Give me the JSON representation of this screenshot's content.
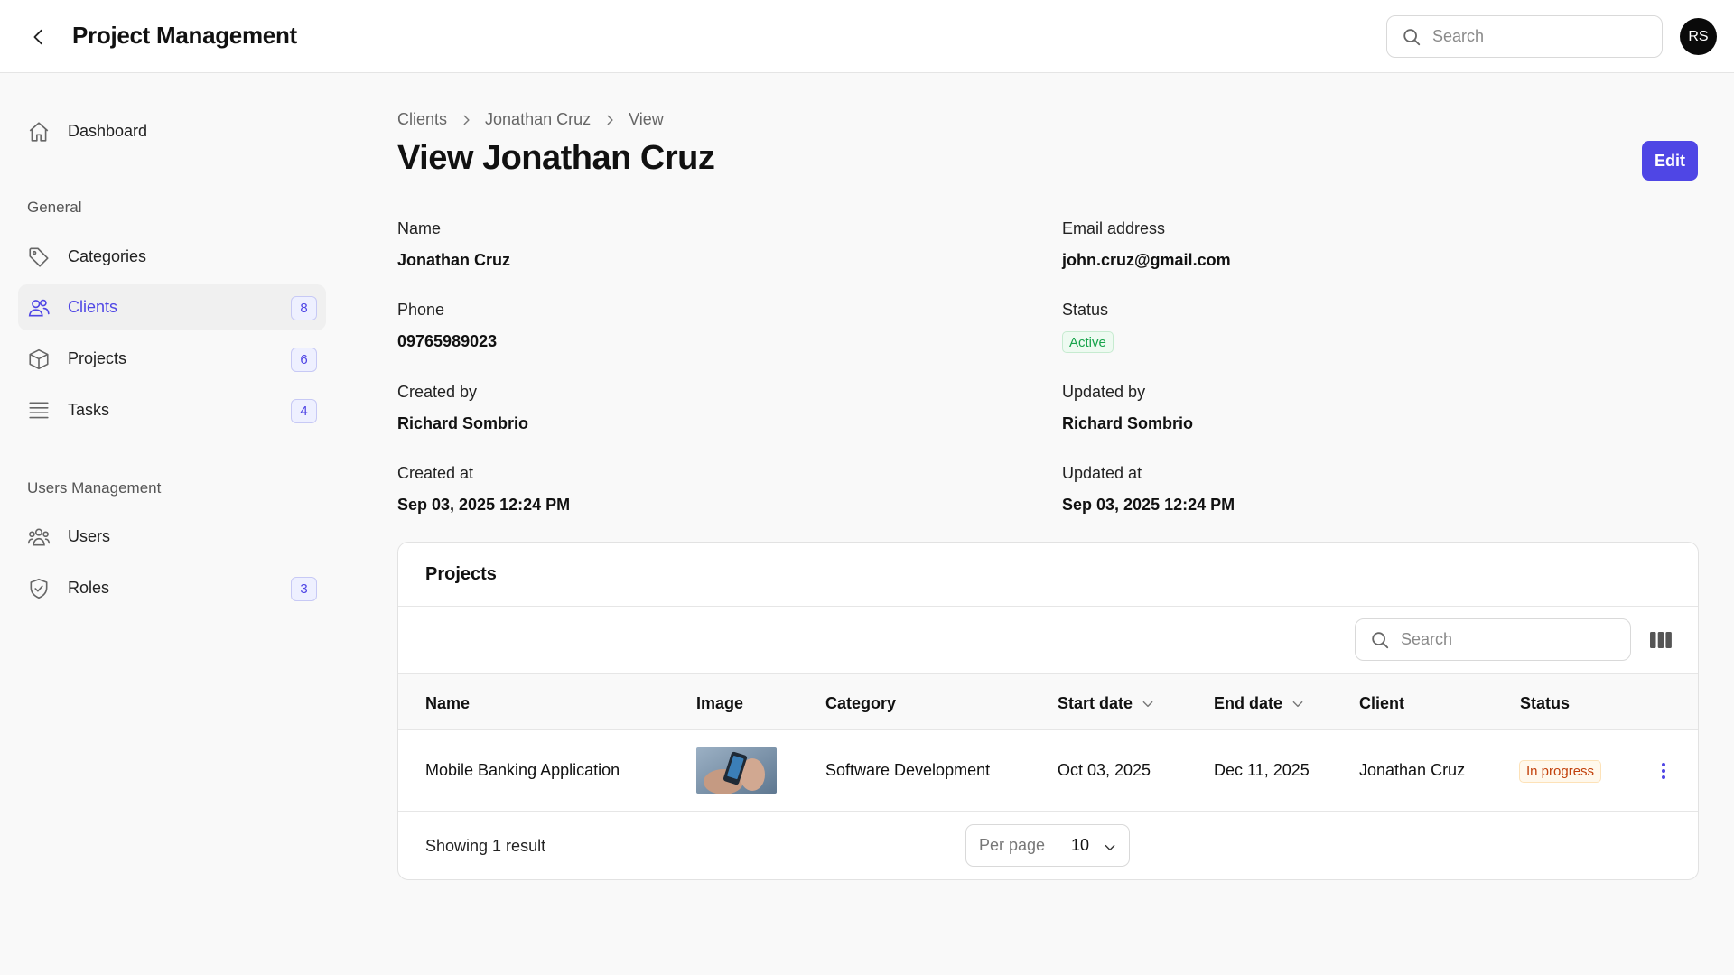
{
  "header": {
    "title": "Project Management",
    "search_placeholder": "Search",
    "avatar_initials": "RS"
  },
  "sidebar": {
    "dashboard": "Dashboard",
    "section_general": "General",
    "items_general": [
      {
        "label": "Categories",
        "icon": "tag-icon"
      },
      {
        "label": "Clients",
        "icon": "users-icon",
        "badge": "8",
        "active": true
      },
      {
        "label": "Projects",
        "icon": "cube-icon",
        "badge": "6"
      },
      {
        "label": "Tasks",
        "icon": "list-icon",
        "badge": "4"
      }
    ],
    "section_users": "Users Management",
    "items_users": [
      {
        "label": "Users",
        "icon": "user-group-icon"
      },
      {
        "label": "Roles",
        "icon": "shield-check-icon",
        "badge": "3"
      }
    ]
  },
  "breadcrumb": [
    "Clients",
    "Jonathan Cruz",
    "View"
  ],
  "page": {
    "title": "View Jonathan Cruz",
    "edit_label": "Edit"
  },
  "details": {
    "name_label": "Name",
    "name": "Jonathan Cruz",
    "email_label": "Email address",
    "email": "john.cruz@gmail.com",
    "phone_label": "Phone",
    "phone": "09765989023",
    "status_label": "Status",
    "status": "Active",
    "created_by_label": "Created by",
    "created_by": "Richard Sombrio",
    "updated_by_label": "Updated by",
    "updated_by": "Richard Sombrio",
    "created_at_label": "Created at",
    "created_at": "Sep 03, 2025 12:24 PM",
    "updated_at_label": "Updated at",
    "updated_at": "Sep 03, 2025 12:24 PM"
  },
  "projects": {
    "title": "Projects",
    "search_placeholder": "Search",
    "columns": [
      "Name",
      "Image",
      "Category",
      "Start date",
      "End date",
      "Client",
      "Status"
    ],
    "rows": [
      {
        "name": "Mobile Banking Application",
        "category": "Software Development",
        "start": "Oct 03, 2025",
        "end": "Dec 11, 2025",
        "client": "Jonathan Cruz",
        "status": "In progress"
      }
    ],
    "showing": "Showing 1 result",
    "per_page_label": "Per page",
    "per_page_value": "10"
  },
  "colors": {
    "accent": "#4f46e5",
    "active_green": "#16a34a",
    "progress_orange": "#c2410c"
  }
}
